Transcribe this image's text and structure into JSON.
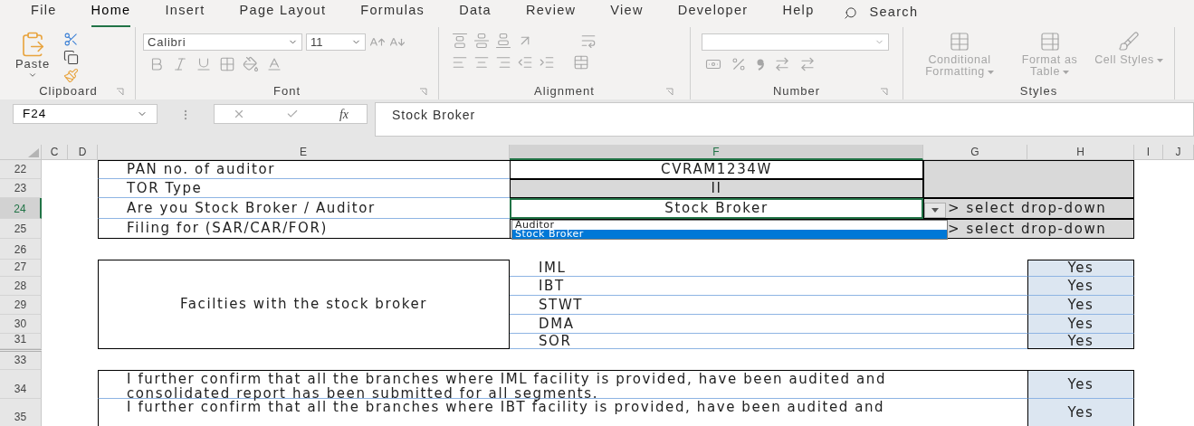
{
  "tabs": [
    {
      "label": "File",
      "selected": false
    },
    {
      "label": "Home",
      "selected": true
    },
    {
      "label": "Insert",
      "selected": false
    },
    {
      "label": "Page Layout",
      "selected": false
    },
    {
      "label": "Formulas",
      "selected": false
    },
    {
      "label": "Data",
      "selected": false
    },
    {
      "label": "Review",
      "selected": false
    },
    {
      "label": "View",
      "selected": false
    },
    {
      "label": "Developer",
      "selected": false
    },
    {
      "label": "Help",
      "selected": false
    }
  ],
  "search": {
    "label": "Search"
  },
  "ribbon": {
    "clipboard": {
      "label": "Clipboard",
      "paste": "Paste"
    },
    "font": {
      "label": "Font",
      "name": "Calibri",
      "size": "11"
    },
    "alignment": {
      "label": "Alignment"
    },
    "number": {
      "label": "Number"
    },
    "styles": {
      "label": "Styles",
      "buttons": [
        "Conditional Formatting",
        "Format as Table",
        "Cell Styles"
      ]
    }
  },
  "formula_bar": {
    "name_box": "F24",
    "function_label": "fx",
    "value": "Stock Broker"
  },
  "columns": [
    {
      "label": "C",
      "selected": false
    },
    {
      "label": "D",
      "selected": false
    },
    {
      "label": "E",
      "selected": false
    },
    {
      "label": "F",
      "selected": true
    },
    {
      "label": "G",
      "selected": false
    },
    {
      "label": "H",
      "selected": false
    },
    {
      "label": "I",
      "selected": false
    },
    {
      "label": "J",
      "selected": false
    }
  ],
  "row_numbers": [
    {
      "label": "22",
      "selected": false
    },
    {
      "label": "23",
      "selected": false
    },
    {
      "label": "24",
      "selected": true
    },
    {
      "label": "25",
      "selected": false
    },
    {
      "label": "26",
      "selected": false
    },
    {
      "label": "27",
      "selected": false
    },
    {
      "label": "28",
      "selected": false
    },
    {
      "label": "29",
      "selected": false
    },
    {
      "label": "30",
      "selected": false
    },
    {
      "label": "31",
      "selected": false
    },
    {
      "label": "33",
      "selected": false
    },
    {
      "label": "34",
      "selected": false
    },
    {
      "label": "35",
      "selected": false
    }
  ],
  "form": [
    {
      "label": "PAN no. of auditor",
      "value": "CVRAM1234W",
      "kind": "input"
    },
    {
      "label": "TOR Type",
      "value": "II",
      "kind": "locked"
    },
    {
      "label": "Are you Stock Broker / Auditor",
      "value": "Stock Broker",
      "kind": "dropdown",
      "note": "> select drop-down"
    },
    {
      "label": "Filing for (SAR/CAR/FOR)",
      "kind": "dropdown",
      "note": "> select drop-down"
    }
  ],
  "dropdown": {
    "options": [
      {
        "label": "Auditor",
        "selected": false
      },
      {
        "label": "Stock Broker",
        "selected": true
      }
    ]
  },
  "facilities": {
    "label": "Facilties with the stock broker",
    "items": [
      {
        "name": "IML",
        "value": "Yes"
      },
      {
        "name": "IBT",
        "value": "Yes"
      },
      {
        "name": "STWT",
        "value": "Yes"
      },
      {
        "name": "DMA",
        "value": "Yes"
      },
      {
        "name": "SOR",
        "value": "Yes"
      }
    ]
  },
  "confirmations": [
    {
      "text": "I further confirm that all the branches where IML facility is provided, have been audited and consolidated report has been submitted for all segments.",
      "value": "Yes"
    },
    {
      "text": "I further confirm that all the branches where IBT facility is provided, have been audited and",
      "value": "Yes"
    }
  ]
}
